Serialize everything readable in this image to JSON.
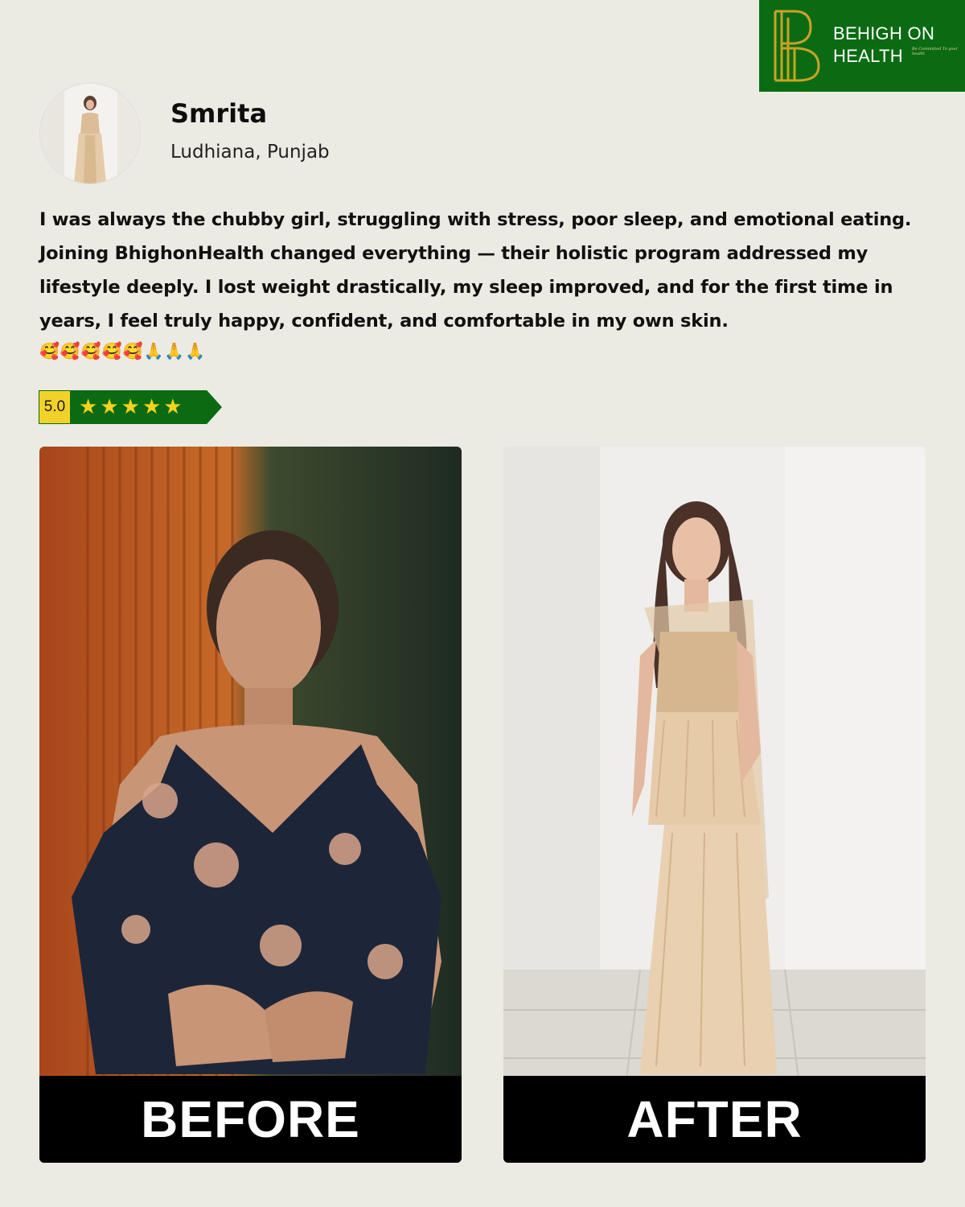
{
  "brand": {
    "line1": "BEHIGH ON",
    "line2": "HEALTH",
    "tagline": "Be Committed To your health",
    "mark": "BH monogram",
    "bg_color": "#0b6b12",
    "accent_color": "#c9a227"
  },
  "profile": {
    "name": "Smrita",
    "location": "Ludhiana, Punjab"
  },
  "testimonial": {
    "text": "I was always the chubby girl, struggling with stress, poor sleep, and emotional eating. Joining BhighonHealth changed everything — their holistic program addressed my lifestyle deeply. I lost weight drastically, my sleep improved, and for the first time in years, I feel truly happy, confident, and comfortable in my own skin.",
    "emojis": "🥰🥰🥰🥰🥰🙏🙏🙏"
  },
  "rating": {
    "score": "5.0",
    "stars": 5,
    "star_icon": "star-icon"
  },
  "photos": {
    "before_label": "BEFORE",
    "after_label": "AFTER"
  }
}
